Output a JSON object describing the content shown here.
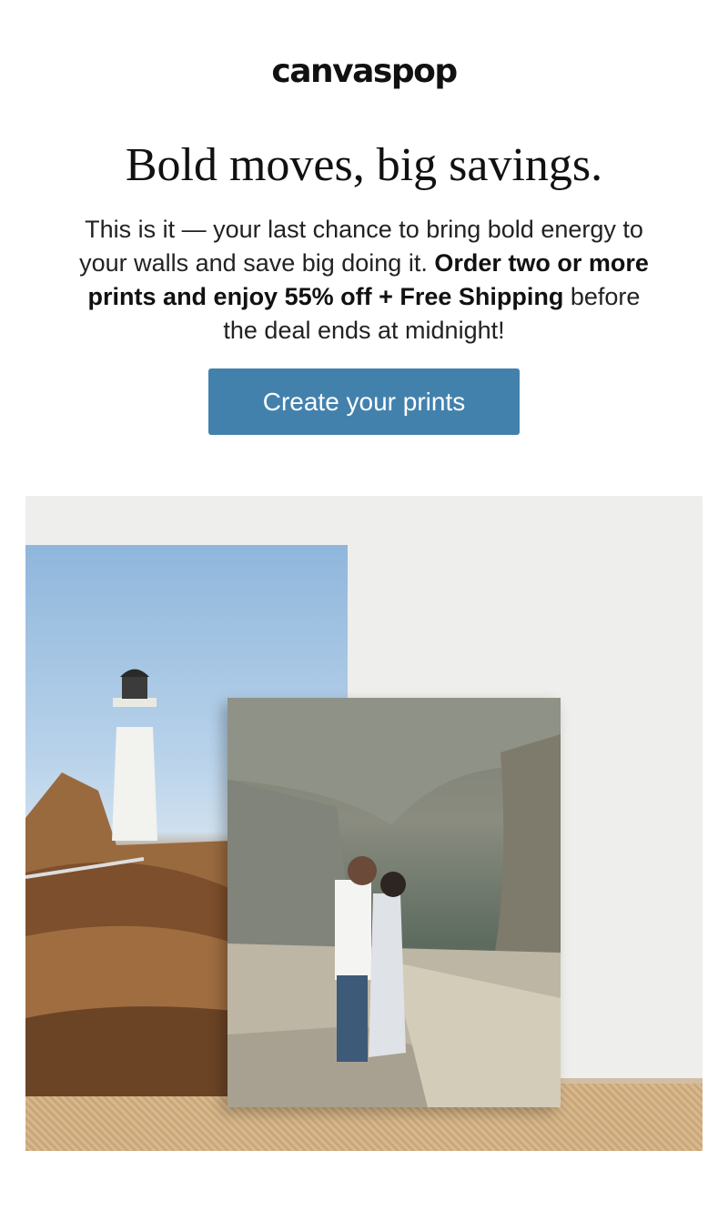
{
  "header": {
    "logo_text": "canvaspop"
  },
  "hero_text": {
    "headline": "Bold moves, big savings.",
    "body_part1": "This is it — your last chance to bring bold energy to your walls and save big doing it. ",
    "body_bold": "Order two or more prints and enjoy 55% off + Free Shipping",
    "body_part2": " before the deal ends at midnight!"
  },
  "cta": {
    "label": "Create your prints",
    "color": "#4381ad"
  },
  "hero_image": {
    "prints": [
      "lighthouse-canvas",
      "couple-canyon-canvas"
    ]
  }
}
